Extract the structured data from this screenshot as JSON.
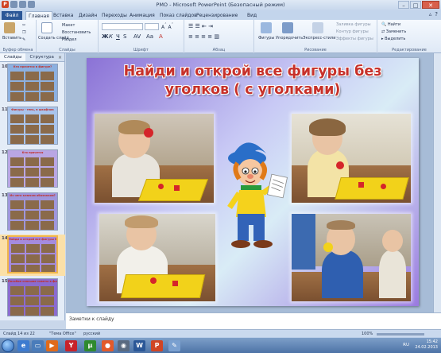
{
  "window": {
    "title": "PMO - Microsoft PowerPoint (Безопасный режим)",
    "app_icon_label": "P"
  },
  "ribbon_tabs": [
    "Файл",
    "Главная",
    "Вставка",
    "Дизайн",
    "Переходы",
    "Анимация",
    "Показ слайдов",
    "Рецензирование",
    "Вид"
  ],
  "ribbon": {
    "clipboard": {
      "paste": "Вставить",
      "group": "Буфер обмена"
    },
    "slides": {
      "new_slide": "Создать слайд",
      "layout": "Макет",
      "reset": "Восстановить",
      "section": "Раздел",
      "group": "Слайды"
    },
    "font": {
      "group": "Шрифт"
    },
    "paragraph": {
      "group": "Абзац"
    },
    "drawing": {
      "shapes": "Фигуры",
      "arrange": "Упорядочить",
      "quick_styles": "Экспресс-стили",
      "fill": "Заливка фигуры",
      "outline": "Контур фигуры",
      "effects": "Эффекты фигуры",
      "group": "Рисование"
    },
    "editing": {
      "find": "Найти",
      "replace": "Заменить",
      "select": "Выделить",
      "group": "Редактирование"
    }
  },
  "left_panel": {
    "tab_slides": "Слайды",
    "tab_outline": "Структура",
    "thumbnails": [
      {
        "num": "10",
        "title": "Кто прячется в фигуре?",
        "bg": "#8cb0e0"
      },
      {
        "num": "11",
        "title": "Фигуры - тень, в шкафчик",
        "bg": "#a9c4ec"
      },
      {
        "num": "12",
        "title": "Кто прячется",
        "bg": "#b9a6e3"
      },
      {
        "num": "13",
        "title": "Из чего ключом обозначим?",
        "bg": "#9f96dc"
      },
      {
        "num": "14",
        "title": "Найди и открой все фигуры без уголков",
        "bg": "#a58bdd",
        "selected": true
      },
      {
        "num": "15",
        "title": "Пособие спасшие советы в фото для детей",
        "bg": "#8b6bcf"
      }
    ]
  },
  "slide": {
    "title_line1": "Найди и открой все фигуры без",
    "title_line2": "уголков ( с уголками)"
  },
  "notes": {
    "placeholder": "Заметки к слайду"
  },
  "status": {
    "slide_counter": "Слайд 14 из 22",
    "theme": "\"Тема Office\"",
    "language": "русский",
    "zoom": "100%"
  },
  "taskbar": {
    "lang": "RU",
    "time": "15:42",
    "date": "24.02.2013"
  },
  "colors": {
    "title_red": "#c7312a",
    "file_tab": "#2b5797"
  }
}
